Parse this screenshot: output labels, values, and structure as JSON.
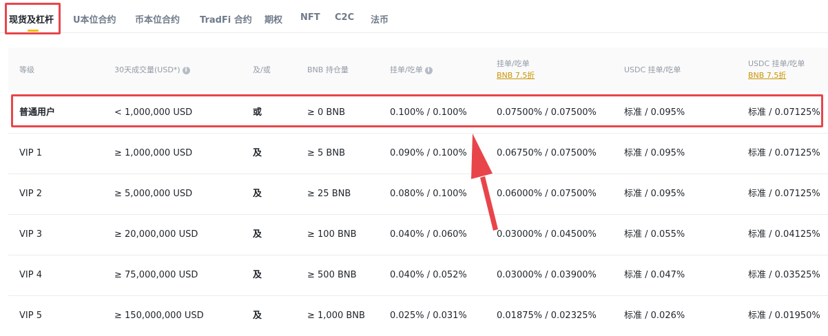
{
  "tabs": [
    {
      "label": "现货及杠杆",
      "active": true
    },
    {
      "label": "U本位合约"
    },
    {
      "label": "币本位合约"
    },
    {
      "label": "TradFi 合约"
    },
    {
      "label": "期权"
    },
    {
      "label": "NFT"
    },
    {
      "label": "C2C"
    },
    {
      "label": "法币"
    }
  ],
  "table": {
    "headers": {
      "level": "等级",
      "volume": "30天成交量(USD*)",
      "and_or": "及/或",
      "bnb": "BNB 持仓量",
      "maker_taker": "挂单/吃单",
      "maker_taker_bnb": "挂单/吃单",
      "maker_taker_bnb_sub": "BNB 7.5折",
      "usdc": "USDC 挂单/吃单",
      "usdc_bnb": "USDC 挂单/吃单",
      "usdc_bnb_sub": "BNB 7.5折"
    },
    "rows": [
      {
        "level": "普通用户",
        "volume": "< 1,000,000 USD",
        "and_or": "或",
        "bnb": "≥ 0 BNB",
        "fee": "0.100% / 0.100%",
        "fee_bnb": "0.07500% / 0.07500%",
        "usdc": "标准 / 0.095%",
        "usdc_bnb": "标准 / 0.07125%"
      },
      {
        "level": "VIP 1",
        "volume": "≥ 1,000,000 USD",
        "and_or": "及",
        "bnb": "≥ 5 BNB",
        "fee": "0.090% / 0.100%",
        "fee_bnb": "0.06750% / 0.07500%",
        "usdc": "标准 / 0.095%",
        "usdc_bnb": "标准 / 0.07125%"
      },
      {
        "level": "VIP 2",
        "volume": "≥ 5,000,000 USD",
        "and_or": "及",
        "bnb": "≥ 25 BNB",
        "fee": "0.080% / 0.100%",
        "fee_bnb": "0.06000% / 0.07500%",
        "usdc": "标准 / 0.095%",
        "usdc_bnb": "标准 / 0.07125%"
      },
      {
        "level": "VIP 3",
        "volume": "≥ 20,000,000 USD",
        "and_or": "及",
        "bnb": "≥ 100 BNB",
        "fee": "0.040% / 0.060%",
        "fee_bnb": "0.03000% / 0.04500%",
        "usdc": "标准 / 0.055%",
        "usdc_bnb": "标准 / 0.04125%"
      },
      {
        "level": "VIP 4",
        "volume": "≥ 75,000,000 USD",
        "and_or": "及",
        "bnb": "≥ 500 BNB",
        "fee": "0.040% / 0.052%",
        "fee_bnb": "0.03000% / 0.03900%",
        "usdc": "标准 / 0.047%",
        "usdc_bnb": "标准 / 0.03525%"
      },
      {
        "level": "VIP 5",
        "volume": "≥ 150,000,000 USD",
        "and_or": "及",
        "bnb": "≥ 1,000 BNB",
        "fee": "0.025% / 0.031%",
        "fee_bnb": "0.01875% / 0.02325%",
        "usdc": "标准 / 0.026%",
        "usdc_bnb": "标准 / 0.01950%"
      }
    ]
  },
  "colors": {
    "accent": "#f0b90b",
    "highlight": "#e8454a",
    "link": "#c99400"
  },
  "icons": {
    "info": "info-icon"
  }
}
